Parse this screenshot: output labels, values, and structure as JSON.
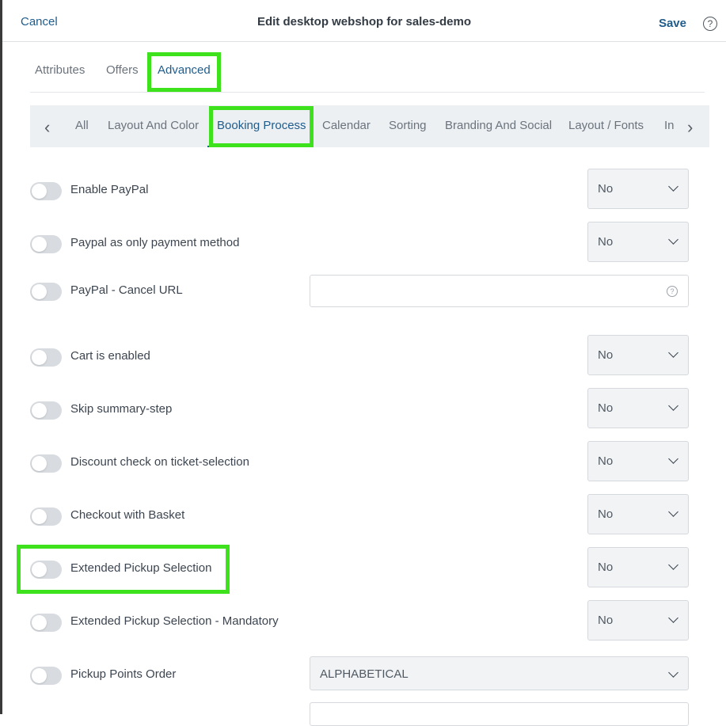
{
  "header": {
    "cancel_label": "Cancel",
    "title": "Edit desktop webshop for sales-demo",
    "save_label": "Save",
    "help_glyph": "?"
  },
  "tabs": [
    "Attributes",
    "Offers",
    "Advanced"
  ],
  "active_tab": "Advanced",
  "subtabs": [
    "All",
    "Layout And Color",
    "Booking Process",
    "Calendar",
    "Sorting",
    "Branding And Social",
    "Layout / Fonts",
    "In"
  ],
  "active_subtab": "Booking Process",
  "settings": [
    {
      "label": "Enable PayPal",
      "value": "No"
    },
    {
      "label": "Paypal as only payment method",
      "value": "No"
    },
    {
      "label": "PayPal - Cancel URL",
      "value": ""
    },
    {
      "label": "Cart is enabled",
      "value": "No"
    },
    {
      "label": "Skip summary-step",
      "value": "No"
    },
    {
      "label": "Discount check on ticket-selection",
      "value": "No"
    },
    {
      "label": "Checkout with Basket",
      "value": "No"
    },
    {
      "label": "Extended Pickup Selection",
      "value": "No"
    },
    {
      "label": "Extended Pickup Selection - Mandatory",
      "value": "No"
    },
    {
      "label": "Pickup Points Order",
      "value": "ALPHABETICAL"
    }
  ],
  "colors": {
    "accent": "#1f5c8c",
    "highlight": "#3de21c",
    "toggle_off": "#d8dce0"
  }
}
